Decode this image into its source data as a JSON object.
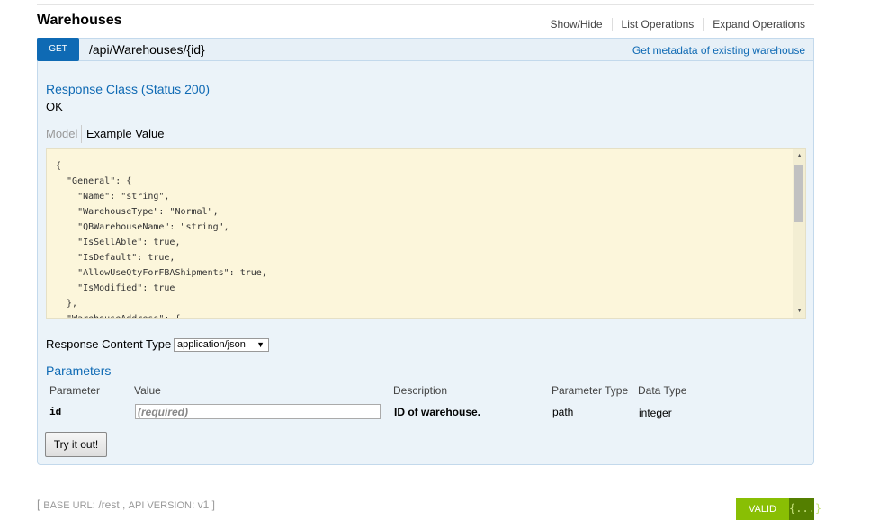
{
  "section": {
    "title": "Warehouses",
    "links": [
      "Show/Hide",
      "List Operations",
      "Expand Operations"
    ]
  },
  "operation": {
    "method": "GET",
    "path": "/api/Warehouses/{id}",
    "summary": "Get metadata of existing warehouse",
    "response_class_title": "Response Class (Status 200)",
    "response_status": "OK",
    "tabs": {
      "model": "Model",
      "example": "Example Value"
    },
    "example_json": "{\n  \"General\": {\n    \"Name\": \"string\",\n    \"WarehouseType\": \"Normal\",\n    \"QBWarehouseName\": \"string\",\n    \"IsSellAble\": true,\n    \"IsDefault\": true,\n    \"AllowUseQtyForFBAShipments\": true,\n    \"IsModified\": true\n  },\n  \"WarehouseAddress\": {",
    "response_content_type_label": "Response Content Type",
    "response_content_type_value": "application/json",
    "parameters_title": "Parameters",
    "parameter_headers": [
      "Parameter",
      "Value",
      "Description",
      "Parameter Type",
      "Data Type"
    ],
    "parameter": {
      "name": "id",
      "placeholder": "(required)",
      "description": "ID of warehouse.",
      "param_type": "path",
      "data_type": "integer"
    },
    "try_button": "Try it out!"
  },
  "footer": {
    "bracket_open": "[ ",
    "base_url_label": "BASE URL",
    "base_url_value": ": /rest , ",
    "api_version_label": "API VERSION",
    "api_version_value": ": v1 ]"
  },
  "validator": {
    "label": "VALID",
    "icon": "{...}"
  },
  "colors": {
    "get_badge": "#0f6ab4",
    "panel_bg": "#ebf3f9",
    "valid_green": "#89bf04",
    "example_bg": "#fcf6db"
  }
}
